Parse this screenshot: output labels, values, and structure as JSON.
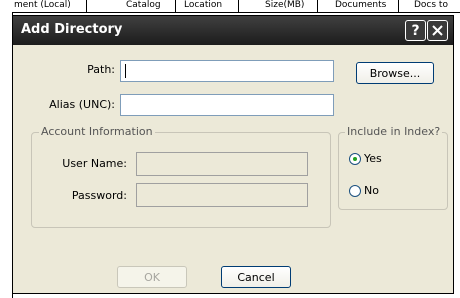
{
  "background": {
    "columns": [
      "ment (Local)",
      "Catalog",
      "Location",
      "Size(MB)",
      "Documents",
      "Docs to"
    ]
  },
  "dialog": {
    "title": "Add Directory",
    "help_glyph": "?",
    "close_glyph": "✕",
    "path_label": "Path:",
    "path_value": "",
    "browse_label": "Browse...",
    "alias_label": "Alias (UNC):",
    "alias_value": "",
    "account_group_label": "Account Information",
    "username_label": "User Name:",
    "username_value": "",
    "password_label": "Password:",
    "password_value": "",
    "index_group_label": "Include in Index?",
    "yes_label": "Yes",
    "no_label": "No",
    "index_selected": "Yes",
    "ok_label": "OK",
    "cancel_label": "Cancel"
  },
  "colors": {
    "title_bar": "#2b2b2b",
    "dialog_bg": "#ece9d8",
    "radio_selected": "#21a121"
  }
}
